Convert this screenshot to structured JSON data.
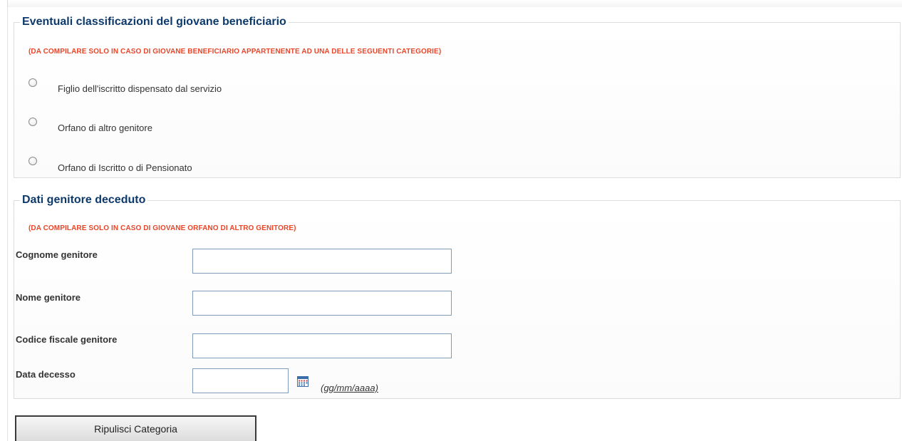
{
  "section_classifications": {
    "legend": "Eventuali classificazioni del giovane beneficiario",
    "note": "(DA COMPILARE SOLO IN CASO DI GIOVANE BENEFICIARIO APPARTENENTE AD UNA DELLE SEGUENTI CATEGORIE)",
    "options": [
      {
        "label": "Figlio dell'iscritto dispensato dal servizio",
        "selected": false
      },
      {
        "label": "Orfano di altro genitore",
        "selected": false
      },
      {
        "label": "Orfano di Iscritto o di Pensionato",
        "selected": false
      }
    ]
  },
  "section_parent": {
    "legend": "Dati genitore deceduto",
    "note": "(DA COMPILARE SOLO IN CASO DI GIOVANE ORFANO DI ALTRO GENITORE)",
    "fields": {
      "surname": {
        "label": "Cognome genitore",
        "value": ""
      },
      "name": {
        "label": "Nome genitore",
        "value": ""
      },
      "tax_code": {
        "label": "Codice fiscale genitore",
        "value": ""
      },
      "death_date": {
        "label": "Data decesso",
        "value": "",
        "format_hint": "(gg/mm/aaaa)"
      }
    },
    "calendar_icon": "calendar-icon"
  },
  "actions": {
    "clear_category_label": "Ripulisci Categoria"
  }
}
